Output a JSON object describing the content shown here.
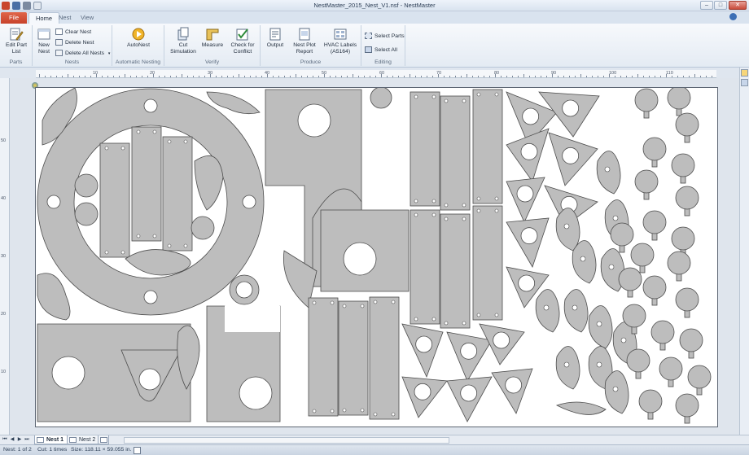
{
  "window": {
    "title": "NestMaster_2015_Nest_V1.nsf - NestMaster",
    "minimize": "–",
    "maximize": "□",
    "close": "✕"
  },
  "tabs": [
    {
      "label": "File"
    },
    {
      "label": "Home"
    },
    {
      "label": "Nest"
    },
    {
      "label": "View"
    }
  ],
  "ribbon": {
    "groups": {
      "parts": "Parts",
      "nests": "Nests",
      "automatic_nesting": "Automatic Nesting",
      "verify": "Verify",
      "produce": "Produce",
      "editing": "Editing"
    },
    "edit_part_list": "Edit Part List",
    "new_nest": "New Nest",
    "clear_nest": "Clear Nest",
    "delete_nest": "Delete Nest",
    "delete_all_nests": "Delete All Nests",
    "autonest": "AutoNest",
    "cut_simulation": "Cut Simulation",
    "measure": "Measure",
    "check_for_conflict": "Check for Conflict",
    "output": "Output",
    "nest_plot_report": "Nest Plot Report",
    "hvac_labels": "HVAC Labels (A5164)",
    "select_parts": "Select Parts",
    "select_all": "Select All"
  },
  "ruler": {
    "h_labels": [
      "10",
      "20",
      "30",
      "40",
      "50",
      "60",
      "70",
      "80",
      "90",
      "100",
      "110"
    ],
    "v_labels": [
      "50",
      "40",
      "30",
      "20",
      "10"
    ]
  },
  "sheet_tabs": [
    {
      "label": "Nest 1",
      "active": true
    },
    {
      "label": "Nest 2",
      "active": false
    }
  ],
  "status": {
    "nest_count": "Nest: 1 of 2",
    "cut_count": "Cut: 1 times",
    "size": "Size: 118.11 × 59.055 in."
  },
  "colors": {
    "part_fill": "#bdbdbd",
    "part_stroke": "#4c4c4c",
    "file_tab": "#d2532f"
  }
}
